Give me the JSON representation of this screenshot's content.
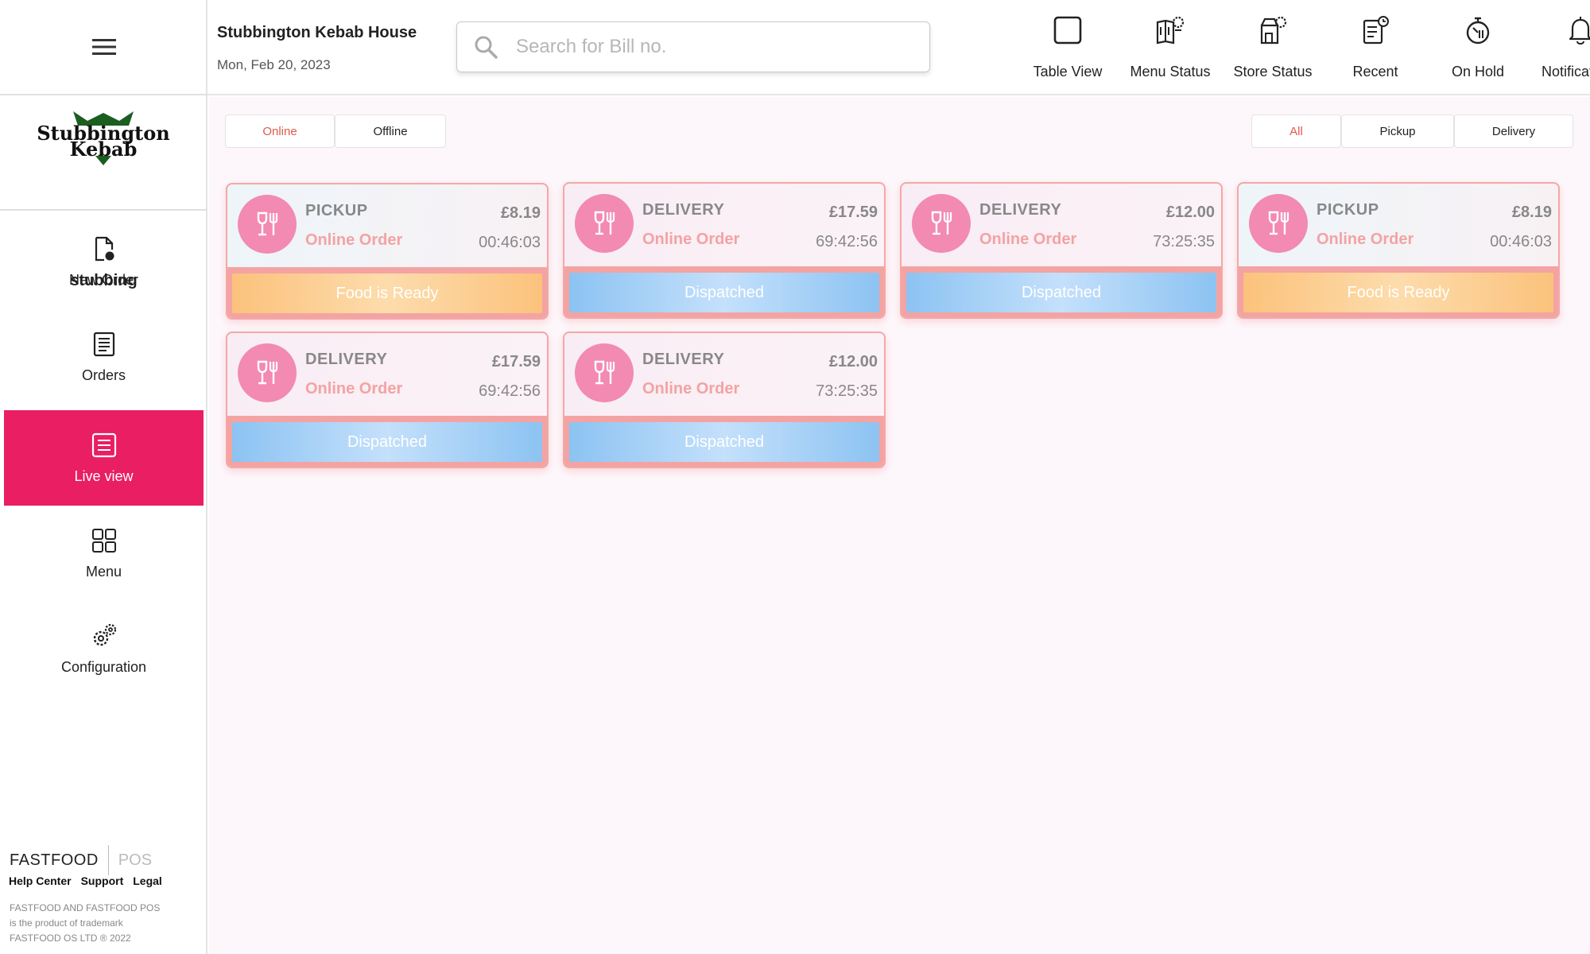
{
  "header": {
    "store_name": "Stubbington Kebab House",
    "date": "Mon, Feb 20, 2023",
    "search_placeholder": "Search for Bill no.",
    "tools": [
      {
        "label": "Table View",
        "icon": "table-view-icon"
      },
      {
        "label": "Menu Status",
        "icon": "menu-status-icon"
      },
      {
        "label": "Store Status",
        "icon": "store-status-icon"
      },
      {
        "label": "Recent",
        "icon": "recent-icon"
      },
      {
        "label": "On Hold",
        "icon": "on-hold-icon"
      },
      {
        "label": "Notifications",
        "icon": "bell-icon"
      }
    ]
  },
  "sidebar": {
    "logo_line1": "Stubbington",
    "logo_line2": "Kebab",
    "brand_name": "stubbing",
    "items": [
      {
        "label": "New Order",
        "icon": "new-order-icon"
      },
      {
        "label": "Orders",
        "icon": "orders-icon"
      },
      {
        "label": "Live view",
        "icon": "live-view-icon",
        "active": true
      },
      {
        "label": "Menu",
        "icon": "menu-grid-icon"
      },
      {
        "label": "Configuration",
        "icon": "gears-icon"
      }
    ],
    "footer": {
      "brand_main": "FASTFOOD",
      "brand_sub": "POS",
      "links": [
        "Help Center",
        "Support",
        "Legal"
      ],
      "legal_line1": "FASTFOOD AND FASTFOOD POS",
      "legal_line2": "is the product of trademark",
      "legal_line3": "FASTFOOD OS LTD ® 2022"
    }
  },
  "filters": {
    "channel": [
      "Online",
      "Offline"
    ],
    "channel_selected": "Online",
    "type": [
      "All",
      "Pickup",
      "Delivery"
    ],
    "type_selected": "All"
  },
  "orders": [
    {
      "type": "PICKUP",
      "source": "Online Order",
      "price": "£8.19",
      "time": "00:46:03",
      "status": "Food is Ready"
    },
    {
      "type": "DELIVERY",
      "source": "Online Order",
      "price": "£17.59",
      "time": "69:42:56",
      "status": "Dispatched"
    },
    {
      "type": "DELIVERY",
      "source": "Online Order",
      "price": "£12.00",
      "time": "73:25:35",
      "status": "Dispatched"
    },
    {
      "type": "PICKUP",
      "source": "Online Order",
      "price": "£8.19",
      "time": "00:46:03",
      "status": "Food is Ready"
    },
    {
      "type": "DELIVERY",
      "source": "Online Order",
      "price": "£17.59",
      "time": "69:42:56",
      "status": "Dispatched"
    },
    {
      "type": "DELIVERY",
      "source": "Online Order",
      "price": "£12.00",
      "time": "73:25:35",
      "status": "Dispatched"
    }
  ],
  "colors": {
    "accent": "#e91e63",
    "card_border": "#f4a7a7",
    "ready": "#fbc27c",
    "dispatched": "#8cc3f2"
  }
}
